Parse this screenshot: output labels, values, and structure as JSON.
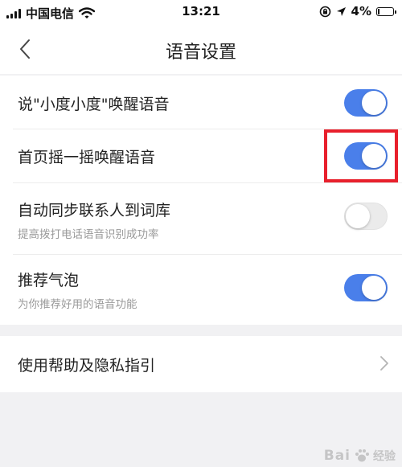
{
  "status_bar": {
    "carrier": "中国电信",
    "time": "13:21",
    "battery": "4%",
    "battery_level": 0.04,
    "icons": [
      "signal-icon",
      "wifi-icon",
      "rotation-lock-icon",
      "location-icon",
      "battery-icon"
    ]
  },
  "nav": {
    "title": "语音设置",
    "back_icon": "chevron-left-icon"
  },
  "settings": {
    "items": [
      {
        "label": "说\"小度小度\"唤醒语音",
        "subtitle": "",
        "enabled": true
      },
      {
        "label": "首页摇一摇唤醒语音",
        "subtitle": "",
        "enabled": true
      },
      {
        "label": "自动同步联系人到词库",
        "subtitle": "提高拨打电话语音识别成功率",
        "enabled": false
      },
      {
        "label": "推荐气泡",
        "subtitle": "为你推荐好用的语音功能",
        "enabled": true
      }
    ],
    "help_link": {
      "label": "使用帮助及隐私指引",
      "icon": "chevron-right-icon"
    }
  },
  "colors": {
    "toggle_on": "#4a7fea",
    "toggle_off": "#ebebeb",
    "highlight_box": "#e8202c",
    "background": "#f1f1f3"
  },
  "watermark": {
    "text": "Bai",
    "suffix": "经验"
  }
}
